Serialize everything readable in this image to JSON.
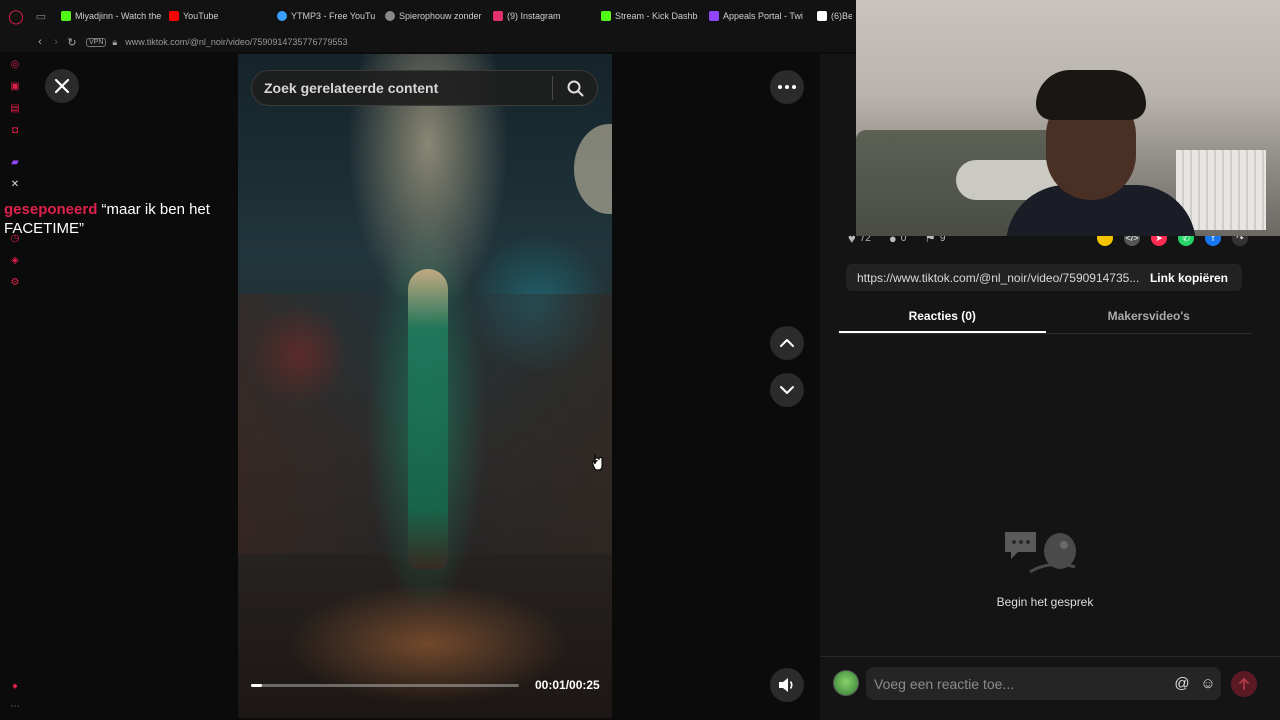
{
  "browser": {
    "tabs": [
      {
        "label": "Miyadjinn - Watch the",
        "color": "#53fc18"
      },
      {
        "label": "YouTube",
        "color": "#ff0000"
      },
      {
        "label": "YTMP3 - Free YouTu",
        "color": "#3aa0ff"
      },
      {
        "label": "Spierophouw zonder",
        "color": "#888888"
      },
      {
        "label": "(9) Instagram",
        "color": "#e1306c"
      },
      {
        "label": "Stream - Kick Dashb",
        "color": "#53fc18"
      },
      {
        "label": "Appeals Portal - Twi",
        "color": "#9146ff"
      },
      {
        "label": "(6)Be",
        "color": "#ffffff"
      }
    ],
    "url": "www.tiktok.com/@nl_noir/video/7590914735776779553",
    "vpn": "VPN"
  },
  "chat_overlay": {
    "username": "geseponeerd",
    "message": " “maar ik ben het FACETIME”"
  },
  "search": {
    "placeholder": "Zoek gerelateerde content"
  },
  "player": {
    "time": "00:01/00:25",
    "progress_fraction": 0.04
  },
  "panel": {
    "likes": "72",
    "comments": "0",
    "saves": "9",
    "link_url": "https://www.tiktok.com/@nl_noir/video/7590914735...",
    "link_copy": "Link kopiëren",
    "tab_comments": "Reacties (0)",
    "tab_creator": "Makersvideo's",
    "empty_text": "Begin het gesprek",
    "comment_placeholder": "Voeg een reactie toe...",
    "share_colors": [
      "#f5c400",
      "#555555",
      "#fe2c55",
      "#25d366",
      "#1877f2",
      "#333333"
    ]
  }
}
